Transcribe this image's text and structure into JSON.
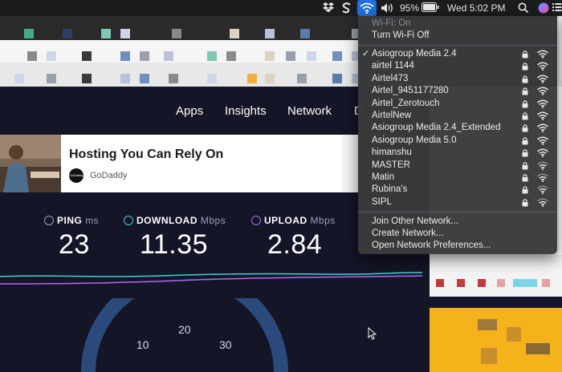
{
  "menubar": {
    "battery_percent": "95%",
    "clock": "Wed 5:02 PM"
  },
  "wifi_menu": {
    "status": "Wi-Fi: On",
    "toggle_label": "Turn Wi-Fi Off",
    "networks": [
      {
        "name": "Asiogroup Media 2.4",
        "connected": true,
        "locked": true
      },
      {
        "name": "airtel 1144",
        "connected": false,
        "locked": true
      },
      {
        "name": "Airtel473",
        "connected": false,
        "locked": true
      },
      {
        "name": "Airtel_9451177280",
        "connected": false,
        "locked": true
      },
      {
        "name": "Airtel_Zerotouch",
        "connected": false,
        "locked": true
      },
      {
        "name": "AirtelNew",
        "connected": false,
        "locked": true
      },
      {
        "name": "Asiogroup Media 2.4_Extended",
        "connected": false,
        "locked": true
      },
      {
        "name": "Asiogroup Media 5.0",
        "connected": false,
        "locked": true
      },
      {
        "name": "himanshu",
        "connected": false,
        "locked": true
      },
      {
        "name": "MASTER",
        "connected": false,
        "locked": true
      },
      {
        "name": "Matin",
        "connected": false,
        "locked": true
      },
      {
        "name": "Rubina's",
        "connected": false,
        "locked": true
      },
      {
        "name": "SIPL",
        "connected": false,
        "locked": true
      }
    ],
    "join_other": "Join Other Network...",
    "create_network": "Create Network...",
    "open_prefs": "Open Network Preferences..."
  },
  "nav": {
    "apps": "Apps",
    "insights": "Insights",
    "network": "Network",
    "more_initial": "D"
  },
  "ad": {
    "title": "Hosting You Can Rely On",
    "brand": "GoDaddy",
    "logo_text": "GoDaddy"
  },
  "speedtest": {
    "ping": {
      "label": "PING",
      "unit": "ms",
      "value": "23"
    },
    "download": {
      "label": "DOWNLOAD",
      "unit": "Mbps",
      "value": "11.35"
    },
    "upload": {
      "label": "UPLOAD",
      "unit": "Mbps",
      "value": "2.84"
    },
    "gauge_ticks": [
      "10",
      "20",
      "30"
    ]
  },
  "colors": {
    "accent_wifi": "#1f6fe0",
    "download_icon": "#3fd1d6",
    "upload_icon": "#b26cf0",
    "page_bg": "#141526"
  }
}
